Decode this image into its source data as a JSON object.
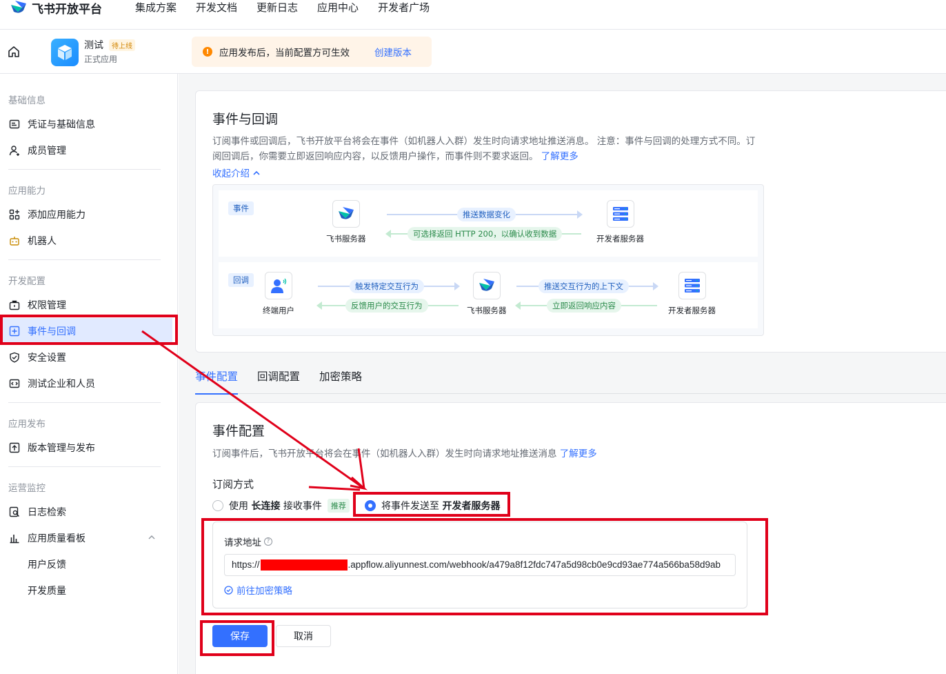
{
  "topnav": {
    "logo_text": "飞书开放平台",
    "items": [
      "集成方案",
      "开发文档",
      "更新日志",
      "应用中心",
      "开发者广场"
    ]
  },
  "app_header": {
    "app_name": "测试",
    "status": "待上线",
    "app_type": "正式应用",
    "notice_text": "应用发布后，当前配置方可生效",
    "notice_link": "创建版本"
  },
  "sidebar": {
    "sections": {
      "basic": "基础信息",
      "capability": "应用能力",
      "dev": "开发配置",
      "release": "应用发布",
      "ops": "运营监控"
    },
    "items": {
      "credentials": "凭证与基础信息",
      "members": "成员管理",
      "add_capability": "添加应用能力",
      "bot": "机器人",
      "permissions": "权限管理",
      "events": "事件与回调",
      "security": "安全设置",
      "test_org": "测试企业和人员",
      "versions": "版本管理与发布",
      "logs": "日志检索",
      "quality": "应用质量看板",
      "feedback": "用户反馈",
      "dev_quality": "开发质量"
    }
  },
  "intro": {
    "title": "事件与回调",
    "desc": "订阅事件或回调后，飞书开放平台将会在事件（如机器人入群）发生时向请求地址推送消息。 注意：事件与回调的处理方式不同。订阅回调后，你需要立即返回响应内容，以反馈用户操作，而事件则不要求返回。",
    "learn_more": "了解更多",
    "collapse": "收起介绍",
    "diagram": {
      "event_tag": "事件",
      "callback_tag": "回调",
      "feishu_server": "飞书服务器",
      "dev_server": "开发者服务器",
      "end_user": "终端用户",
      "push_data": "推送数据变化",
      "return_200": "可选择返回 HTTP 200，以确认收到数据",
      "trigger": "触发特定交互行为",
      "feedback": "反馈用户的交互行为",
      "push_context": "推送交互行为的上下文",
      "return_now": "立即返回响应内容"
    }
  },
  "tabs": [
    "事件配置",
    "回调配置",
    "加密策略"
  ],
  "event_config": {
    "title": "事件配置",
    "desc": "订阅事件后，飞书开放平台将会在事件（如机器人入群）发生时向请求地址推送消息",
    "learn_more": "了解更多",
    "sub_label": "订阅方式",
    "option1": {
      "prefix": "使用",
      "bold": "长连接",
      "suffix": "接收事件",
      "tag": "推荐"
    },
    "option2": {
      "prefix": "将事件发送至",
      "bold": "开发者服务器"
    },
    "url_label": "请求地址",
    "url_prefix": "https://",
    "url_suffix": ".appflow.aliyunnest.com/webhook/a479a8f12fdc747a5d98cb0e9cd93ae774a566ba58d9ab",
    "goto_encrypt": "前往加密策略",
    "save": "保存",
    "cancel": "取消"
  },
  "colors": {
    "primary": "#3370ff",
    "annotation": "#e0001a"
  }
}
